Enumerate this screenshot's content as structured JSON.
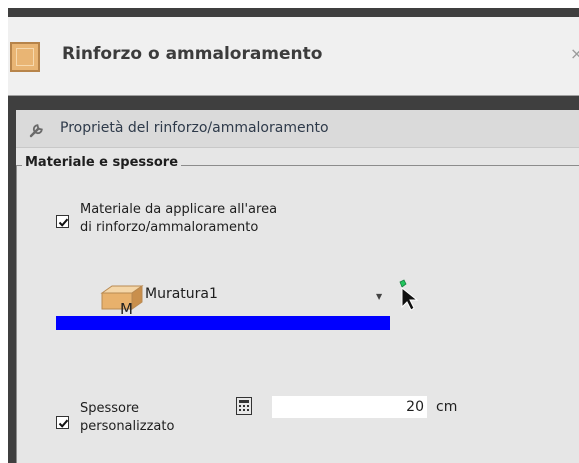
{
  "window": {
    "title": "Rinforzo o ammaloramento",
    "close_glyph": "×",
    "icon": "material-block-icon"
  },
  "panel": {
    "title": "Proprietà del rinforzo/ammaloramento",
    "icon": "wrench-icon"
  },
  "group": {
    "legend": "Materiale e spessore",
    "material_checkbox": {
      "checked": true,
      "label_line1": "Materiale da applicare all'area",
      "label_line2": "di rinforzo/ammaloramento"
    },
    "material_combo": {
      "value": "Muratura1",
      "icon_letter": "M",
      "arrow": "▼"
    },
    "color_bar": "#0000ff",
    "thickness_checkbox": {
      "checked": true,
      "label_line1": "Spessore",
      "label_line2": "personalizzato"
    },
    "thickness": {
      "value": "20",
      "unit": "cm"
    }
  }
}
